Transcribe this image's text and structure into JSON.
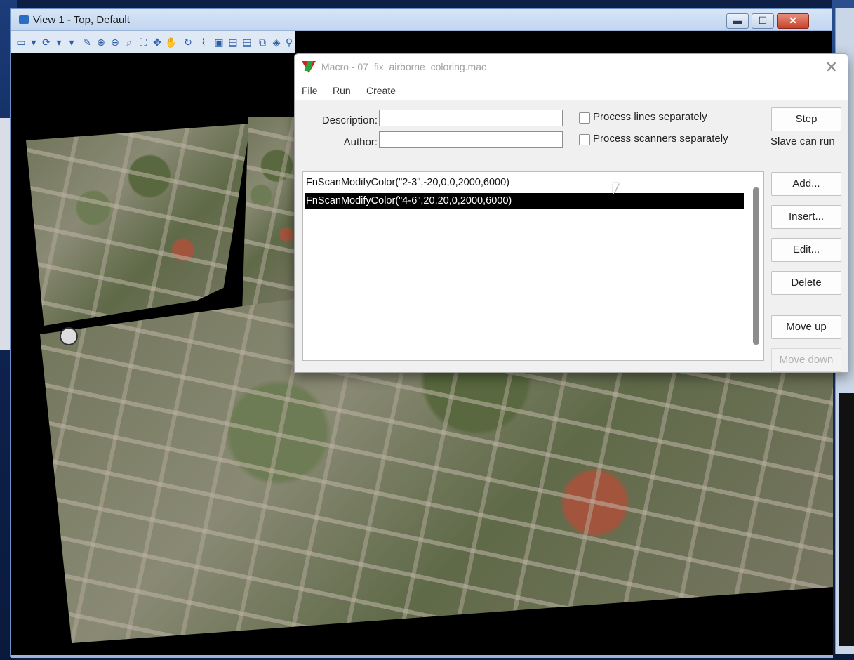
{
  "view_window": {
    "title": "View 1 - Top, Default",
    "controls": {
      "minimize": "▬",
      "maximize": "☐",
      "close": "✕"
    }
  },
  "toolbar": {
    "icons": [
      "view-icon",
      "dropdown-icon",
      "rotate-icon",
      "dropdown-icon",
      "dropdown-icon",
      "brush-icon",
      "zoom-in-icon",
      "zoom-out-icon",
      "zoom-tool-icon",
      "fit-view-icon",
      "pan-icon",
      "hand-icon",
      "rotate-view-icon",
      "clip-icon",
      "settings-icon",
      "display-icon",
      "display-icon",
      "box-icon",
      "shield-icon",
      "people-icon",
      "pin-icon"
    ]
  },
  "macro_dialog": {
    "title": "Macro - 07_fix_airborne_coloring.mac",
    "close": "✕",
    "menu": [
      "File",
      "Run",
      "Create"
    ],
    "description_label": "Description:",
    "description_value": "",
    "author_label": "Author:",
    "author_value": "",
    "process_lines_label": "Process lines separately",
    "process_scanners_label": "Process scanners separately",
    "step_label": "Step",
    "slave_label": "Slave can run",
    "commands": [
      {
        "text": "FnScanModifyColor(\"2-3\",-20,0,0,2000,6000)",
        "selected": false
      },
      {
        "text": "FnScanModifyColor(\"4-6\",20,20,0,2000,6000)",
        "selected": true
      }
    ],
    "buttons": {
      "add": "Add...",
      "insert": "Insert...",
      "edit": "Edit...",
      "delete": "Delete",
      "move_up": "Move up",
      "move_down": "Move down"
    }
  }
}
